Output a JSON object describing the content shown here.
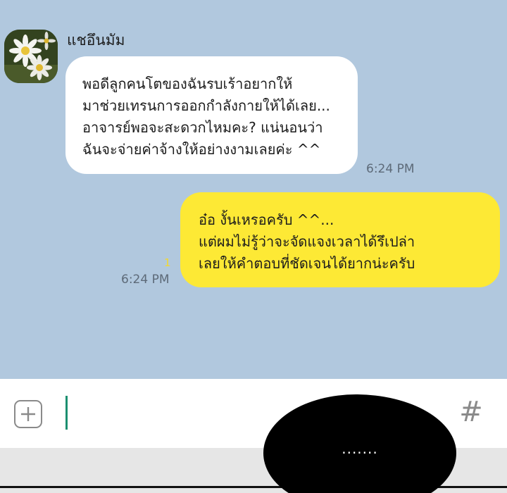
{
  "chat": {
    "contact_name": "แชอึนมัม",
    "avatar_icon": "daisy-flowers-photo",
    "background_color": "#b1c8de",
    "incoming": {
      "lines": [
        "พอดีลูกคนโตของฉันรบเร้าอยากให้",
        "มาช่วยเทรนการออกกำลังกายให้ได้เลย...",
        "อาจารย์พอจะสะดวกไหมคะ? แน่นอนว่า",
        "ฉันจะจ่ายค่าจ้างให้อย่างงามเลยค่ะ ^^"
      ],
      "time": "6:24 PM",
      "bubble_color": "#ffffff"
    },
    "outgoing": {
      "lines": [
        "อ๋อ งั้นเหรอครับ ^^...",
        "แต่ผมไม่รู้ว่าจะจัดแจงเวลาได้รึเปล่า",
        "เลยให้คำตอบที่ชัดเจนได้ยากน่ะครับ"
      ],
      "time": "6:24 PM",
      "read_count": "1",
      "bubble_color": "#fde935"
    }
  },
  "input_bar": {
    "plus_icon": "plus-box-icon",
    "caret_color": "#1c8f70",
    "hash_icon": "#"
  },
  "overlay": {
    "speech_text": "......."
  }
}
